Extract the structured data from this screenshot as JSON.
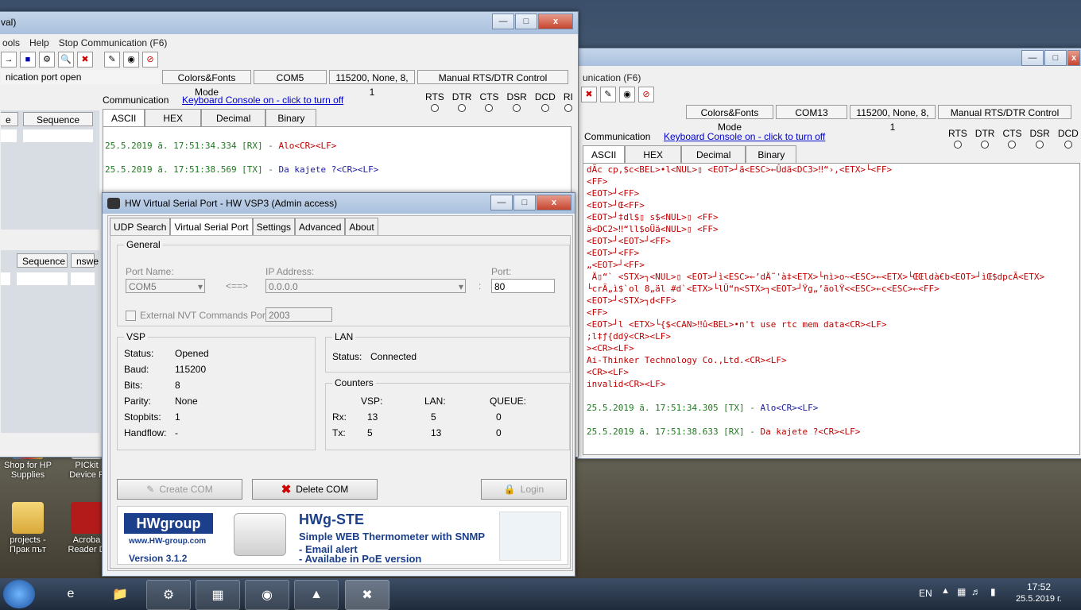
{
  "desktop": {
    "icons": [
      {
        "label": "Shop for HP Supplies"
      },
      {
        "label": "PICkit Device F"
      },
      {
        "label": "projects - Прак път"
      },
      {
        "label": "Acroba Reader D"
      }
    ]
  },
  "left_terminal": {
    "title_fragment": "val)",
    "menu": [
      "ools",
      "Help",
      "Stop Communication  (F6)"
    ],
    "status": {
      "port_state": "nication port open",
      "mode": "Colors&Fonts Mode",
      "port": "COM5",
      "settings": "115200, None, 8, 1",
      "rtsdtr": "Manual RTS/DTR Control"
    },
    "communication_label": "Communication",
    "keyboard_link": "Keyboard Console on - click to turn off",
    "signals": [
      "RTS",
      "DTR",
      "CTS",
      "DSR",
      "DCD",
      "RI"
    ],
    "tabs": [
      "ASCII",
      "HEX",
      "Decimal",
      "Binary"
    ],
    "side_headers": [
      "e",
      "Sequence"
    ],
    "side_headers2": [
      "Sequence",
      "nswe"
    ],
    "console_lines": [
      {
        "ts": "25.5.2019 ã. 17:51:34.334 [RX] - ",
        "msg": "Alo<CR><LF>",
        "cls": "red"
      },
      {
        "ts": "25.5.2019 ã. 17:51:38.569 [TX] - ",
        "msg": "Da kajete ?<CR><LF>",
        "cls": "blue"
      }
    ]
  },
  "right_terminal": {
    "menu_fragment": "unication  (F6)",
    "status": {
      "mode": "Colors&Fonts Mode",
      "port": "COM13",
      "settings": "115200, None, 8, 1",
      "rtsdtr": "Manual RTS/DTR Control"
    },
    "communication_label": "Communication",
    "keyboard_link": "Keyboard Console on - click to turn off",
    "signals": [
      "RTS",
      "DTR",
      "CTS",
      "DSR",
      "DCD"
    ],
    "tabs": [
      "ASCII",
      "HEX",
      "Decimal",
      "Binary"
    ],
    "garbage_lines": [
      "dÃc cp,$c<BEL>•l<NUL>▯ <EOT>┘ä<ESC>←Ûdä<DC3>‼“›,<ETX>└<FF>",
      "<FF>",
      "<EOT>┘<FF>",
      "<EOT>┘Œ<FF>",
      "<EOT>┘‡dl$▯ s$<NUL>▯ <FF>",
      "ä<DC2>‼“ll$oÜä<NUL>▯ <FF>",
      "<EOT>┘<EOT>┘<FF>",
      "<EOT>┘<FF>",
      "„<EOT>┘<FF>",
      " Ä▯“` <STX>┐<NUL>▯ <EOT>┘ì<ESC>←’dÄ˜'à‡<ETX>└nì>o~<ESC>←<ETX>└ŒŒldà€b<EOT>┘ìŒ$dpcÃ<ETX>",
      "└crÃ„ì$`ol 8„äl #d`<ETX>└lÜ“n<STX>┐<EOT>┘Ÿg„’ãolŸ<<ESC>←c<ESC>←<FF>",
      "<EOT>┘<STX>┐d<FF>",
      "<FF>",
      "<EOT>┘l <ETX>└{$<CAN>‼û<BEL>•n't use rtc mem data<CR><LF>",
      ";l‡ƒ{ddÿ<CR><LF>",
      "><CR><LF>",
      "Ai-Thinker Technology Co.,Ltd.<CR><LF>",
      "<CR><LF>",
      "invalid<CR><LF>"
    ],
    "log_lines": [
      {
        "ts": "25.5.2019 ã. 17:51:34.305 [TX] - ",
        "msg": "Alo<CR><LF>"
      },
      {
        "ts": "25.5.2019 ã. 17:51:38.633 [RX] - ",
        "msg": "Da kajete ?<CR><LF>"
      }
    ]
  },
  "vsp": {
    "title": "HW Virtual Serial Port - HW VSP3 (Admin access)",
    "tabs": [
      "UDP Search",
      "Virtual Serial Port",
      "Settings",
      "Advanced",
      "About"
    ],
    "general": {
      "legend": "General",
      "port_name_label": "Port Name:",
      "port_name_value": "COM5",
      "arrow": "<==>",
      "ip_label": "IP Address:",
      "ip_value": "0.0.0.0",
      "colon": ":",
      "port_label": "Port:",
      "port_value": "80",
      "nvt_label": "External NVT Commands Port:",
      "nvt_value": "2003"
    },
    "vsp_box": {
      "legend": "VSP",
      "rows": [
        {
          "k": "Status:",
          "v": "Opened"
        },
        {
          "k": "Baud:",
          "v": "115200"
        },
        {
          "k": "Bits:",
          "v": "8"
        },
        {
          "k": "Parity:",
          "v": "None"
        },
        {
          "k": "Stopbits:",
          "v": "1"
        },
        {
          "k": "Handflow:",
          "v": "-"
        }
      ]
    },
    "lan_box": {
      "legend": "LAN",
      "status_label": "Status:",
      "status_value": "Connected"
    },
    "counters": {
      "legend": "Counters",
      "headers": [
        "VSP:",
        "LAN:",
        "QUEUE:"
      ],
      "rows": [
        {
          "k": "Rx:",
          "vsp": "13",
          "lan": "5",
          "queue": "0"
        },
        {
          "k": "Tx:",
          "vsp": "5",
          "lan": "13",
          "queue": "0"
        }
      ]
    },
    "buttons": {
      "create": "Create COM",
      "delete": "Delete COM",
      "login": "Login"
    },
    "banner": {
      "logo_text": "HWgroup",
      "logo_url": "www.HW-group.com",
      "version": "Version  3.1.2",
      "product": "HWg-STE",
      "line1": "Simple WEB Thermometer with SNMP",
      "line2": " - Email alert",
      "line3": " - Availabe in PoE version"
    }
  },
  "taskbar": {
    "lang": "EN",
    "time": "17:52",
    "date": "25.5.2019 г."
  }
}
